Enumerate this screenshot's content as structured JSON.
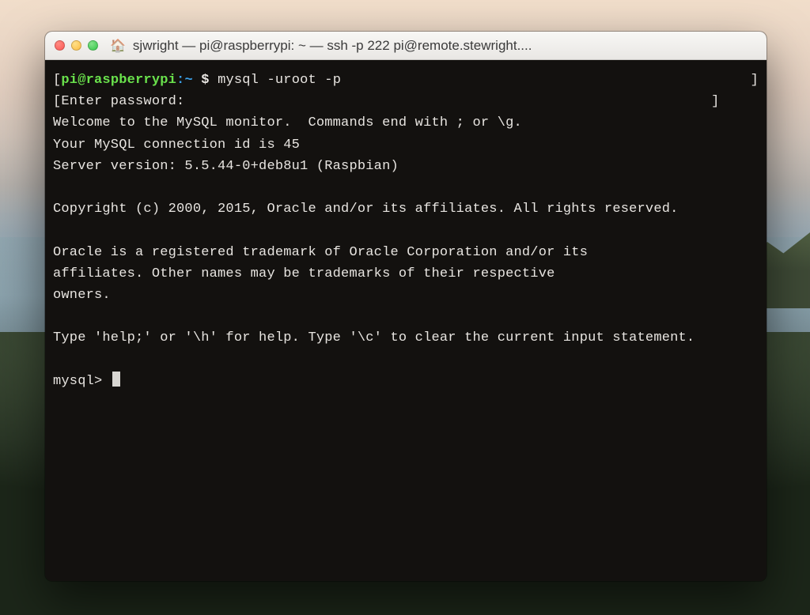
{
  "title": "sjwright — pi@raspberrypi: ~ — ssh -p 222 pi@remote.stewright....",
  "prompt": {
    "bracket_open": "[",
    "user": "pi",
    "at": "@",
    "host": "raspberrypi",
    "path": ":~",
    "dollar": " $ ",
    "bracket_close": "]"
  },
  "command": "mysql -uroot -p",
  "body_lines": [
    "[Enter password:                                                                ]",
    "Welcome to the MySQL monitor.  Commands end with ; or \\g.",
    "Your MySQL connection id is 45",
    "Server version: 5.5.44-0+deb8u1 (Raspbian)",
    "",
    "Copyright (c) 2000, 2015, Oracle and/or its affiliates. All rights reserved.",
    "",
    "Oracle is a registered trademark of Oracle Corporation and/or its",
    "affiliates. Other names may be trademarks of their respective",
    "owners.",
    "",
    "Type 'help;' or '\\h' for help. Type '\\c' to clear the current input statement.",
    ""
  ],
  "mysql_prompt": "mysql> ",
  "icons": {
    "proxy": "🏠"
  }
}
